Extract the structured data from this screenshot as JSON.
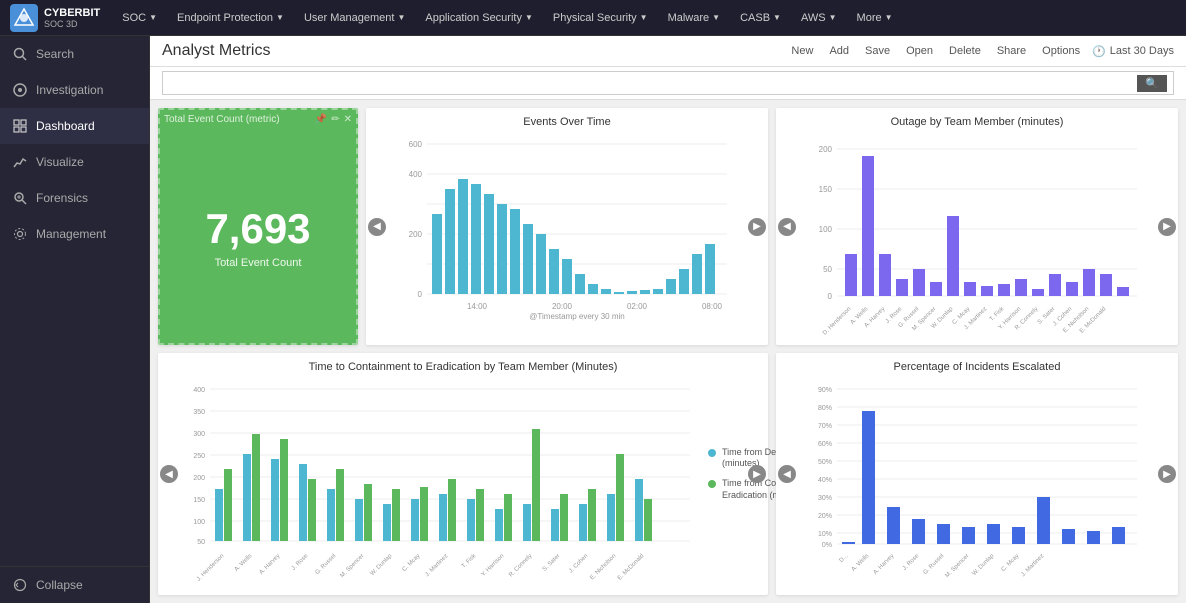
{
  "app": {
    "logo_text": "CYBERBIT",
    "logo_sub": "SOC 3D"
  },
  "topnav": {
    "items": [
      {
        "label": "SOC",
        "id": "soc"
      },
      {
        "label": "Endpoint Protection",
        "id": "endpoint"
      },
      {
        "label": "User Management",
        "id": "user-mgmt"
      },
      {
        "label": "Application Security",
        "id": "app-sec"
      },
      {
        "label": "Physical Security",
        "id": "physical-sec"
      },
      {
        "label": "Malware",
        "id": "malware"
      },
      {
        "label": "CASB",
        "id": "casb"
      },
      {
        "label": "AWS",
        "id": "aws"
      },
      {
        "label": "More",
        "id": "more"
      }
    ]
  },
  "sidebar": {
    "items": [
      {
        "label": "Search",
        "id": "search",
        "icon": "🔍",
        "active": false
      },
      {
        "label": "Investigation",
        "id": "investigation",
        "icon": "🔬",
        "active": false
      },
      {
        "label": "Dashboard",
        "id": "dashboard",
        "icon": "⊞",
        "active": true
      },
      {
        "label": "Visualize",
        "id": "visualize",
        "icon": "📊",
        "active": false
      },
      {
        "label": "Forensics",
        "id": "forensics",
        "icon": "🔎",
        "active": false
      },
      {
        "label": "Management",
        "id": "management",
        "icon": "⚙",
        "active": false
      }
    ],
    "collapse_label": "Collapse"
  },
  "toolbar": {
    "title": "Analyst Metrics",
    "buttons": [
      "New",
      "Add",
      "Save",
      "Open",
      "Delete",
      "Share",
      "Options"
    ],
    "time_range": "Last 30 Days",
    "time_icon": "🕐"
  },
  "search": {
    "placeholder": "",
    "value": ""
  },
  "widgets": {
    "metric": {
      "title": "Total Event Count (metric)",
      "value": "7,693",
      "label": "Total Event Count"
    },
    "events_over_time": {
      "title": "Events Over Time",
      "x_labels": [
        "14:00",
        "20:00",
        "02:00",
        "08:00"
      ],
      "x_axis_label": "@Timestamp every 30 min",
      "y_max": 600
    },
    "outage_by_team": {
      "title": "Outage by Team Member (minutes)",
      "y_max": 200
    },
    "containment": {
      "title": "Time to Containment to Eradication by Team Member (Minutes)",
      "y_max": 400,
      "legend": [
        {
          "label": "Time from Detection to Containment (minutes)",
          "color": "#4db6d0"
        },
        {
          "label": "Time from Containment to Eradication (minutes)",
          "color": "#5cb85c"
        }
      ]
    },
    "incidents_escalated": {
      "title": "Percentage of Incidents Escalated",
      "y_labels": [
        "0%",
        "10%",
        "20%",
        "30%",
        "40%",
        "50%",
        "60%",
        "70%",
        "80%",
        "90%"
      ]
    }
  },
  "chart_nav": {
    "left": "◀",
    "right": "▶"
  }
}
